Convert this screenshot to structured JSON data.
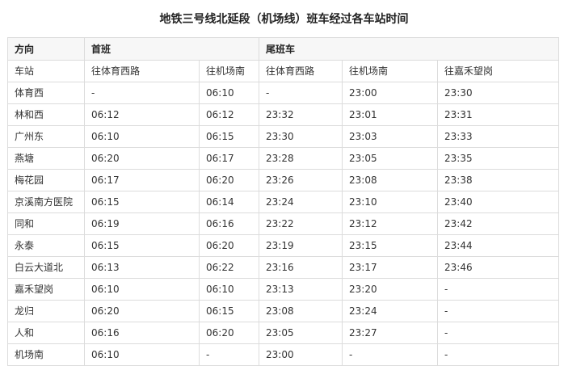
{
  "title": "地铁三号线北延段（机场线）班车经过各车站时间",
  "header": {
    "group_row": [
      "方向",
      "首班",
      "尾班车"
    ],
    "dir_row": [
      "车站",
      "往体育西路",
      "往机场南",
      "往体育西路",
      "往机场南",
      "往嘉禾望岗"
    ]
  },
  "rows": [
    [
      "体育西",
      "-",
      "06:10",
      "-",
      "23:00",
      "23:30"
    ],
    [
      "林和西",
      "06:12",
      "06:12",
      "23:32",
      "23:01",
      "23:31"
    ],
    [
      "广州东",
      "06:10",
      "06:15",
      "23:30",
      "23:03",
      "23:33"
    ],
    [
      "燕塘",
      "06:20",
      "06:17",
      "23:28",
      "23:05",
      "23:35"
    ],
    [
      "梅花园",
      "06:17",
      "06:20",
      "23:26",
      "23:08",
      "23:38"
    ],
    [
      "京溪南方医院",
      "06:15",
      "06:14",
      "23:24",
      "23:10",
      "23:40"
    ],
    [
      "同和",
      "06:19",
      "06:16",
      "23:22",
      "23:12",
      "23:42"
    ],
    [
      "永泰",
      "06:15",
      "06:20",
      "23:19",
      "23:15",
      "23:44"
    ],
    [
      "白云大道北",
      "06:13",
      "06:22",
      "23:16",
      "23:17",
      "23:46"
    ],
    [
      "嘉禾望岗",
      "06:10",
      "06:10",
      "23:13",
      "23:20",
      "-"
    ],
    [
      "龙归",
      "06:20",
      "06:15",
      "23:08",
      "23:24",
      "-"
    ],
    [
      "人和",
      "06:16",
      "06:20",
      "23:05",
      "23:27",
      "-"
    ],
    [
      "机场南",
      "06:10",
      "-",
      "23:00",
      "-",
      "-"
    ]
  ]
}
